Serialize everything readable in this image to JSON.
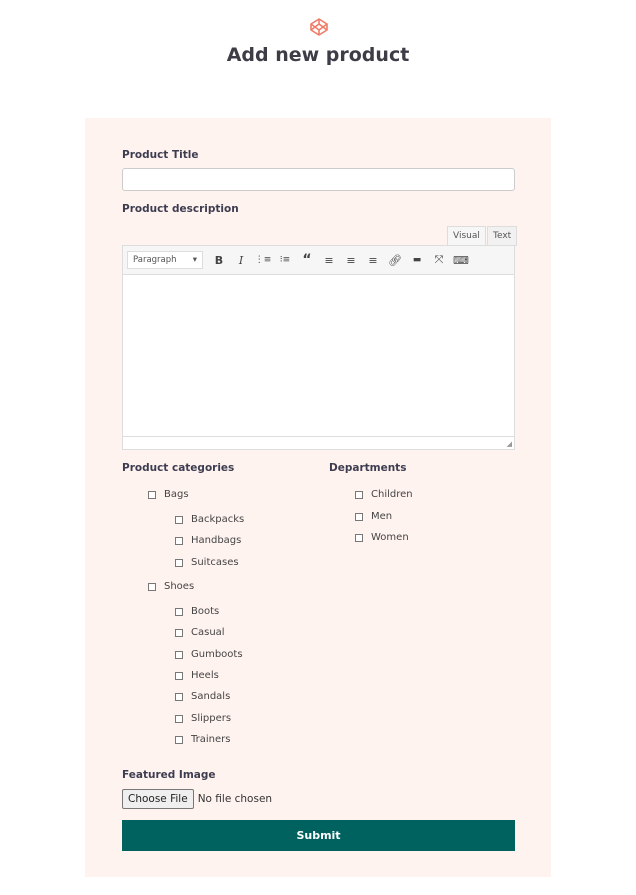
{
  "header": {
    "title": "Add new product",
    "logo_icon": "codepen-icon",
    "accent": "#f07c68"
  },
  "form": {
    "title_label": "Product Title",
    "title_value": "",
    "description_label": "Product description",
    "editor": {
      "tabs": [
        "Visual",
        "Text"
      ],
      "active_tab": "Visual",
      "format": "Paragraph",
      "tools": [
        "bold-icon",
        "italic-icon",
        "bullet-list-icon",
        "numbered-list-icon",
        "blockquote-icon",
        "align-left-icon",
        "align-center-icon",
        "align-right-icon",
        "link-icon",
        "read-more-icon",
        "fullscreen-icon",
        "toolbar-toggle-icon"
      ]
    },
    "categories_label": "Product categories",
    "categories": [
      {
        "label": "Bags",
        "children": [
          "Backpacks",
          "Handbags",
          "Suitcases"
        ]
      },
      {
        "label": "Shoes",
        "children": [
          "Boots",
          "Casual",
          "Gumboots",
          "Heels",
          "Sandals",
          "Slippers",
          "Trainers"
        ]
      }
    ],
    "departments_label": "Departments",
    "departments": [
      "Children",
      "Men",
      "Women"
    ],
    "image_label": "Featured Image",
    "choose_file": "Choose File",
    "no_file": "No file chosen",
    "submit": "Submit",
    "submit_color": "#00625f"
  }
}
